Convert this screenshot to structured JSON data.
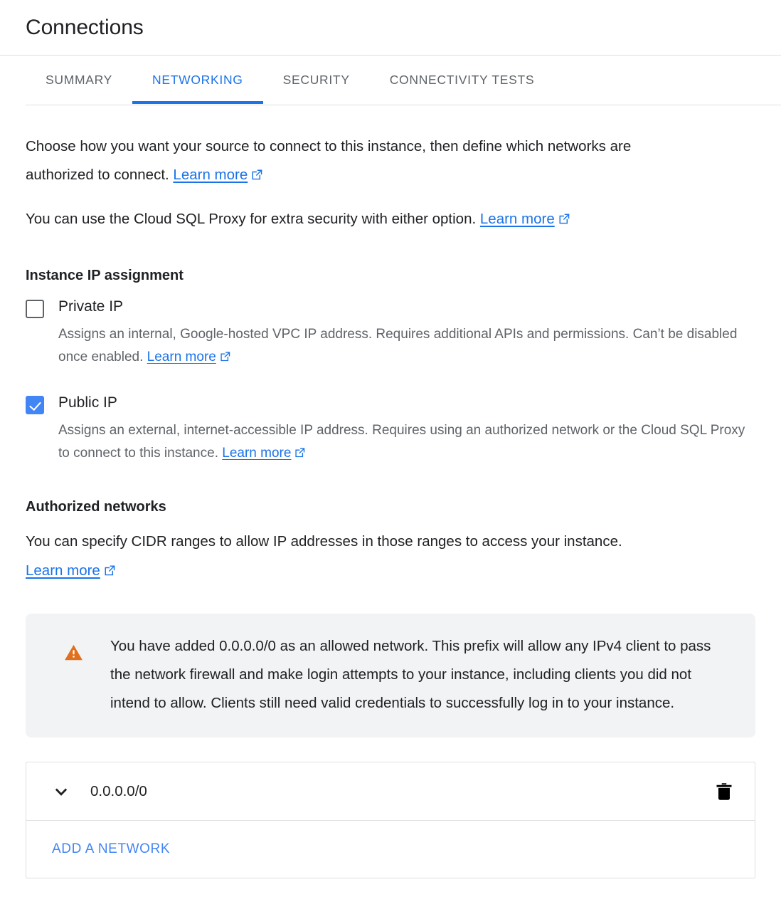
{
  "header": {
    "title": "Connections"
  },
  "tabs": [
    {
      "label": "SUMMARY",
      "active": false
    },
    {
      "label": "NETWORKING",
      "active": true
    },
    {
      "label": "SECURITY",
      "active": false
    },
    {
      "label": "CONNECTIVITY TESTS",
      "active": false
    }
  ],
  "intro": {
    "line1_text": "Choose how you want your source to connect to this instance, then define which networks are authorized to connect.",
    "line1_link": "Learn more",
    "line2_text": "You can use the Cloud SQL Proxy for extra security with either option.",
    "line2_link": "Learn more"
  },
  "instance_ip": {
    "heading": "Instance IP assignment",
    "private": {
      "label": "Private IP",
      "checked": false,
      "description": "Assigns an internal, Google-hosted VPC IP address. Requires additional APIs and permissions. Can’t be disabled once enabled.",
      "link": "Learn more"
    },
    "public": {
      "label": "Public IP",
      "checked": true,
      "description": "Assigns an external, internet-accessible IP address. Requires using an authorized network or the Cloud SQL Proxy to connect to this instance.",
      "link": "Learn more"
    }
  },
  "authorized_networks": {
    "heading": "Authorized networks",
    "description": "You can specify CIDR ranges to allow IP addresses in those ranges to access your instance.",
    "link": "Learn more",
    "warning": "You have added 0.0.0.0/0 as an allowed network. This prefix will allow any IPv4 client to pass the network firewall and make login attempts to your instance, including clients you did not intend to allow. Clients still need valid credentials to successfully log in to your instance.",
    "rows": [
      {
        "cidr": "0.0.0.0/0"
      }
    ],
    "add_label": "ADD A NETWORK"
  },
  "colors": {
    "accent_blue": "#1a73e8",
    "link_blue": "#4285f4",
    "warning_orange": "#e37400",
    "text_primary": "#202124",
    "text_secondary": "#5f6368",
    "divider": "#e0e0e0",
    "callout_bg": "#f1f3f4"
  }
}
